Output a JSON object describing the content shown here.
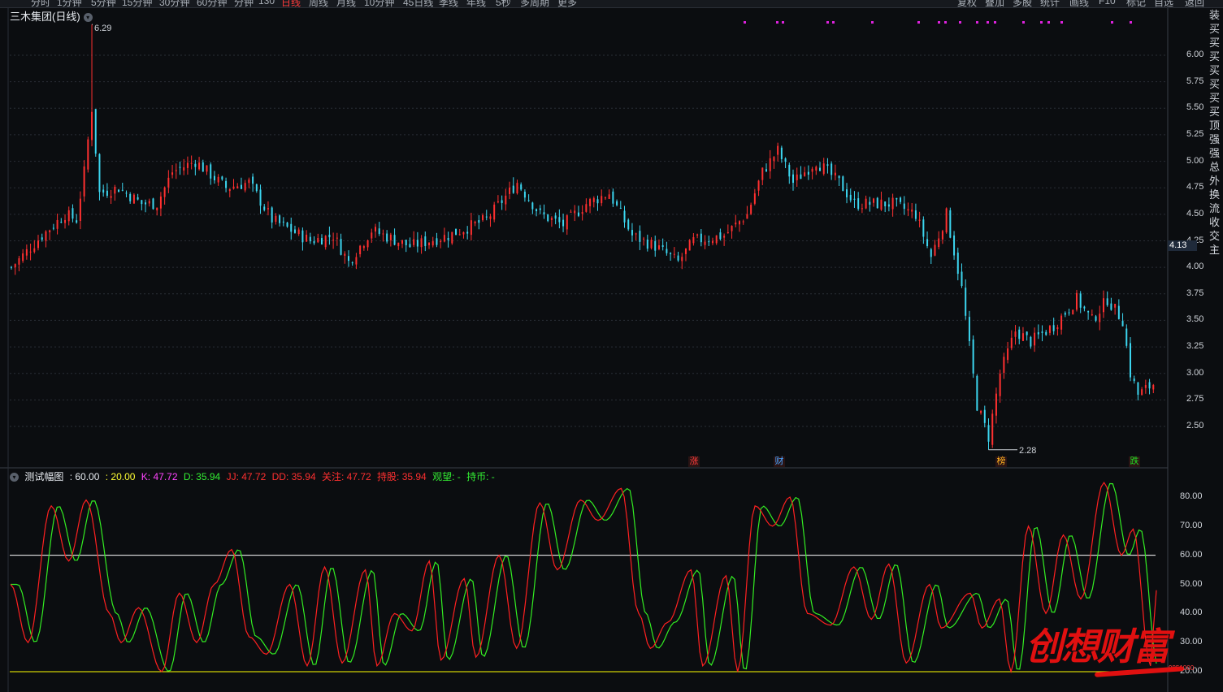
{
  "toolbar": {
    "tabs": [
      "分时",
      "1分钟",
      "5分钟",
      "15分钟",
      "30分钟",
      "60分钟",
      "分钟",
      "130",
      "日线",
      "周线",
      "月线",
      "10分钟",
      "45日线",
      "季线",
      "年线",
      "5秒",
      "多周期",
      "更多"
    ],
    "active_tab": "日线",
    "right_tabs": [
      "复权",
      "叠加",
      "多股",
      "统计",
      "画线",
      "F10",
      "标记",
      "自选",
      "返回"
    ]
  },
  "stock": {
    "name": "三木集团(日线)"
  },
  "price_axis": {
    "labels": [
      "6.00",
      "5.75",
      "5.50",
      "5.25",
      "5.00",
      "4.75",
      "4.50",
      "4.25",
      "4.00",
      "3.75",
      "3.50",
      "3.25",
      "3.00",
      "2.75",
      "2.50"
    ],
    "current": "4.13"
  },
  "annotations": {
    "high": "6.29",
    "low": "2.28"
  },
  "badges": [
    {
      "text": "涨",
      "color": "#ff3b3b"
    },
    {
      "text": "财",
      "color": "#4aa3ff"
    },
    {
      "text": "榜",
      "color": "#ffb020"
    },
    {
      "text": "跌",
      "color": "#22dd22"
    }
  ],
  "indicator": {
    "name": "测试幅图",
    "p1": ": 60.00",
    "p2": ": 20.00",
    "k": "K: 47.72",
    "d": "D: 35.94",
    "jj": "JJ: 47.72",
    "dd": "DD: 35.94",
    "gz": "关注: 47.72",
    "cg": "持股: 35.94",
    "gw": "观望: -",
    "cb": "持币: -",
    "axis": [
      "80.00",
      "70.00",
      "60.00",
      "50.00",
      "40.00",
      "30.00",
      "20.00"
    ]
  },
  "right_panel": [
    "装",
    "买",
    "买",
    "买",
    "买",
    "买",
    "买",
    "买",
    "顶",
    "强",
    "强",
    "总",
    "外",
    "换",
    "流",
    "收",
    "交",
    "主"
  ],
  "watermark": {
    "text": "创想财富",
    "sub": "9951000"
  },
  "colors": {
    "up": "#ff3030",
    "down": "#3cd6f0",
    "k": "#ff2020",
    "d": "#33ee22",
    "line60": "#ffffff",
    "line20": "#ffff00",
    "dots": "#dd22dd"
  }
}
